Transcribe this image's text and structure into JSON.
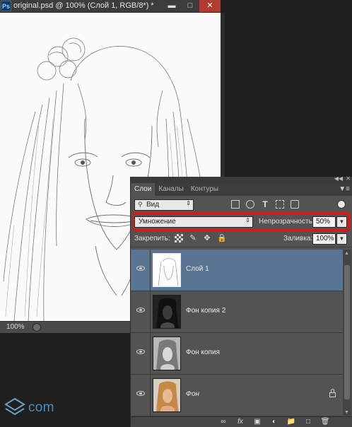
{
  "document": {
    "app_icon": "Ps",
    "title": "original.psd @ 100% (Слой 1, RGB/8*) *",
    "window_buttons": [
      "minimize-icon",
      "maximize-icon",
      "close-icon"
    ],
    "zoom": "100%"
  },
  "layers_panel": {
    "tabs": [
      {
        "label": "Слои",
        "active": true
      },
      {
        "label": "Каналы",
        "active": false
      },
      {
        "label": "Контуры",
        "active": false
      }
    ],
    "filter": {
      "kind_label": "Вид",
      "icons": [
        "image-filter-icon",
        "adjustment-filter-icon",
        "text-filter-icon",
        "shape-filter-icon",
        "smart-object-filter-icon"
      ]
    },
    "blend_mode": "Умножение",
    "opacity_label": "Непрозрачность:",
    "opacity_value": "50%",
    "lock_label": "Закрепить:",
    "lock_icons": [
      "lock-transparent-icon",
      "lock-image-icon",
      "lock-position-icon",
      "lock-all-icon"
    ],
    "fill_label": "Заливка:",
    "fill_value": "100%",
    "layers": [
      {
        "name": "Слой 1",
        "selected": true,
        "visible": true,
        "locked": false,
        "thumb": "sketch"
      },
      {
        "name": "Фон копия 2",
        "selected": false,
        "visible": true,
        "locked": false,
        "thumb": "dark"
      },
      {
        "name": "Фон копия",
        "selected": false,
        "visible": true,
        "locked": false,
        "thumb": "grey"
      },
      {
        "name": "Фон",
        "selected": false,
        "visible": true,
        "locked": true,
        "thumb": "color"
      }
    ],
    "footer_icons": [
      "link-layers-icon",
      "fx-icon",
      "add-mask-icon",
      "adjustment-layer-icon",
      "new-group-icon",
      "new-layer-icon",
      "delete-layer-icon"
    ]
  },
  "watermark": "com",
  "colors": {
    "selection": "#587594",
    "highlight_border": "#d51a1a"
  }
}
